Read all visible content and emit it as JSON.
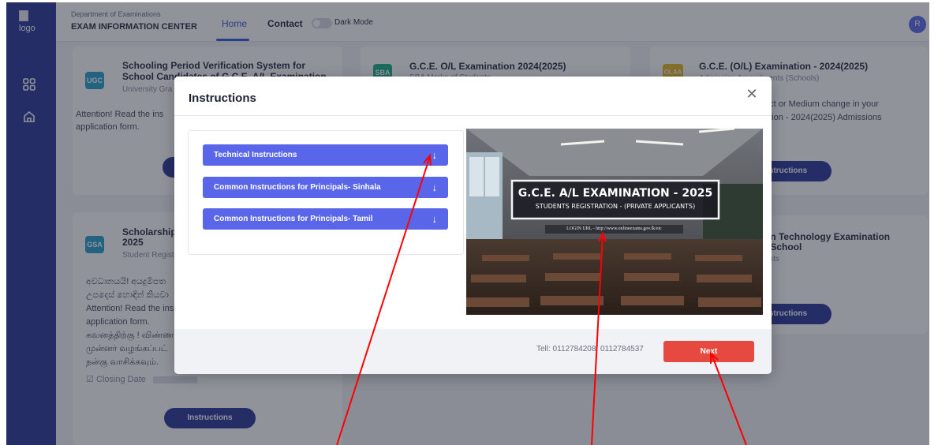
{
  "header": {
    "logo_alt": "logo",
    "department": "Department of Examinations",
    "title": "EXAM INFORMATION CENTER",
    "nav_home": "Home",
    "nav_contact": "Contact",
    "dark_mode_label": "Dark Mode",
    "avatar_initial": "R"
  },
  "cards": {
    "ugc": {
      "badge": "UGC",
      "badge_color": "#2fa3c9",
      "title_line1": "Schooling Period Verification System for",
      "title_line2": "School Candidates of G.C.E. A/L Examination",
      "subtitle": "University Gra",
      "text_line1": "Attention! Read the ins",
      "text_line2": "application form."
    },
    "sba": {
      "badge": "SBA",
      "badge_color": "#1db48a",
      "title": "G.C.E. O/L Examination 2024(2025)",
      "subtitle": "SBA Marks of Students"
    },
    "olaa": {
      "badge": "OLAA",
      "badge_color": "#e9b826",
      "title": "G.C.E. (O/L) Examination - 2024(2025)",
      "subtitle": "Admission Amendments (Schools)",
      "text_line1": "ect or Medium change in your",
      "text_line2": "ation - 2024(2025) Admissions",
      "button": "structions"
    },
    "gsa": {
      "badge": "GSA",
      "badge_color": "#2fa3c9",
      "title_line1": "Scholarship",
      "title_line2": "2025",
      "subtitle": "Student Regist",
      "text_lines": [
        "අවධානයයි! අයදුම්පත",
        "උපදෙස් හොඳින් කියවා",
        "Attention! Read the ins",
        "application form.",
        "கவனத்திற்கு ! விண்ண",
        "முன்னர் வழங்கப்பட்",
        "நன்கு வாசிக்கவும்."
      ],
      "closing_label": "Closing Date",
      "button": "Instructions"
    },
    "ict": {
      "title_line1": "on Technology Examination",
      "title_line2": "- School",
      "subtitle": "ents",
      "button": "structions"
    }
  },
  "modal": {
    "title": "Instructions",
    "close_glyph": "✕",
    "instructions": [
      {
        "label": "Technical Instructions",
        "arrow": "↓"
      },
      {
        "label": "Common Instructions for Principals- Sinhala",
        "arrow": "↓"
      },
      {
        "label": "Common Instructions for Principals- Tamil",
        "arrow": "↓"
      }
    ],
    "promo": {
      "headline": "G.C.E. A/L EXAMINATION - 2025",
      "subheadline": "STUDENTS REGISTRATION - (PRIVATE APPLICANTS)",
      "login_url": "LOGIN URL -   http://www.onlineexams.gov.lk/eic"
    },
    "tel": "Tell: 0112784208/ 0112784537",
    "next_label": "Next"
  }
}
